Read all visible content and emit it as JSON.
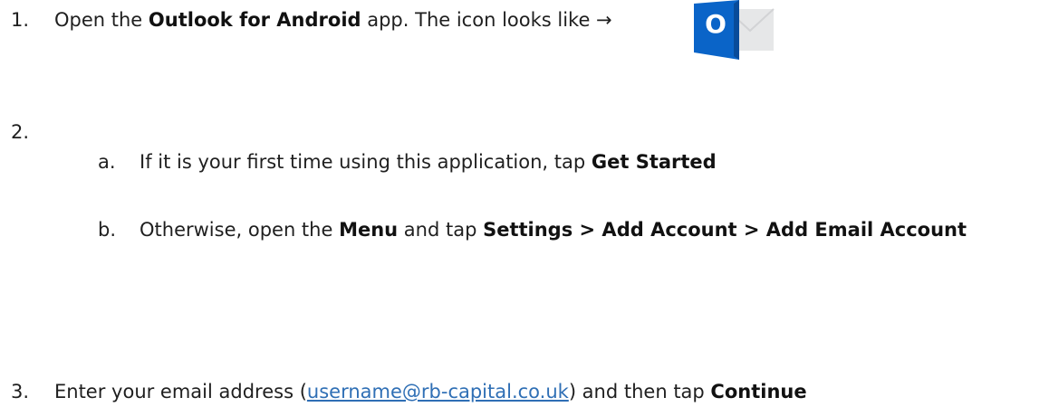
{
  "steps": [
    {
      "number": "1.",
      "pre": "Open the ",
      "bold": "Outlook for Android",
      "post": " app. The icon looks like →",
      "icon": "outlook-app-icon",
      "icon_letter": "O"
    },
    {
      "number": "2.",
      "substeps": [
        {
          "letter": "a.",
          "pre": "If it is your first time using this application, tap ",
          "bold": "Get Started"
        },
        {
          "letter": "b.",
          "pre": "Otherwise, open the ",
          "bold1": "Menu",
          "mid": " and tap ",
          "bold2": "Settings > Add Account > Add Email Account"
        }
      ]
    },
    {
      "number": "3.",
      "pre": "Enter your email address (",
      "link": "username@rb-capital.co.uk",
      "mid": ") and then tap ",
      "bold": "Continue"
    }
  ],
  "colors": {
    "text": "#1f1f1f",
    "link": "#2f6fb5",
    "outlook_blue": "#0a64c8",
    "outlook_dark_blue": "#084b9a",
    "envelope": "#e9eaeb"
  }
}
